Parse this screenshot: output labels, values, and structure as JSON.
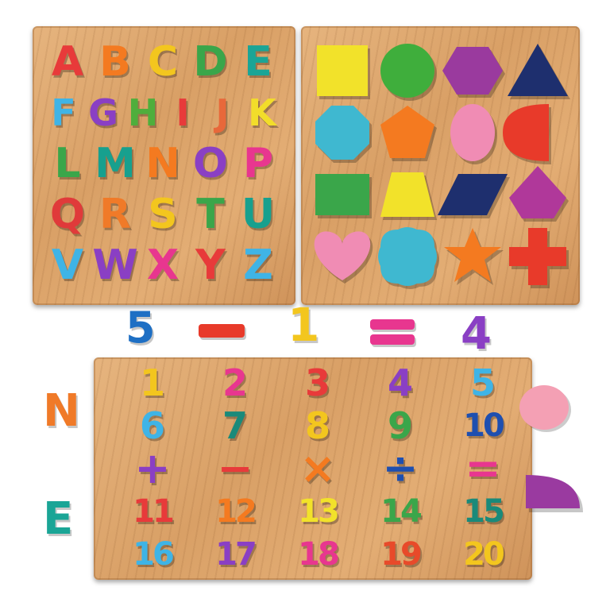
{
  "alphabet_board": {
    "letters": [
      {
        "ch": "A",
        "color": "#e83a3a"
      },
      {
        "ch": "B",
        "color": "#f47a20"
      },
      {
        "ch": "C",
        "color": "#f3c61e"
      },
      {
        "ch": "D",
        "color": "#3aa64a"
      },
      {
        "ch": "E",
        "color": "#1aa596"
      },
      {
        "ch": "F",
        "color": "#3fb4e6"
      },
      {
        "ch": "G",
        "color": "#8a3fc4"
      },
      {
        "ch": "H",
        "color": "#4fae3c"
      },
      {
        "ch": "I",
        "color": "#e83a3a"
      },
      {
        "ch": "J",
        "color": "#e8683a"
      },
      {
        "ch": "K",
        "color": "#f2dd2a"
      },
      {
        "ch": "L",
        "color": "#3aa64a"
      },
      {
        "ch": "M",
        "color": "#17a08e"
      },
      {
        "ch": "N",
        "color": "#f47a20"
      },
      {
        "ch": "O",
        "color": "#8a3fc4"
      },
      {
        "ch": "P",
        "color": "#e8368f"
      },
      {
        "ch": "Q",
        "color": "#e03a3a"
      },
      {
        "ch": "R",
        "color": "#f07a28"
      },
      {
        "ch": "S",
        "color": "#f3c61e"
      },
      {
        "ch": "T",
        "color": "#3aa64a"
      },
      {
        "ch": "U",
        "color": "#17a08e"
      },
      {
        "ch": "V",
        "color": "#3fb4e6"
      },
      {
        "ch": "W",
        "color": "#8a3fc4"
      },
      {
        "ch": "X",
        "color": "#e8368f"
      },
      {
        "ch": "Y",
        "color": "#e83a3a"
      },
      {
        "ch": "Z",
        "color": "#3fb4e6"
      }
    ]
  },
  "shape_board": {
    "shapes": [
      {
        "name": "square",
        "color": "#f2e22a"
      },
      {
        "name": "circle",
        "color": "#3fae3c"
      },
      {
        "name": "hexagon",
        "color": "#9a3a9e"
      },
      {
        "name": "triangle",
        "color": "#1e2f6e"
      },
      {
        "name": "octagon",
        "color": "#3fb8d0"
      },
      {
        "name": "pentagon",
        "color": "#f47a20"
      },
      {
        "name": "oval",
        "color": "#f08cb4"
      },
      {
        "name": "semicircle",
        "color": "#e83a2a"
      },
      {
        "name": "rectangle",
        "color": "#3aa64a"
      },
      {
        "name": "trapezoid",
        "color": "#f2e22a"
      },
      {
        "name": "parallelogram",
        "color": "#1e2f6e"
      },
      {
        "name": "kite",
        "color": "#b0389a"
      },
      {
        "name": "heart",
        "color": "#f08cb4"
      },
      {
        "name": "quatrefoil",
        "color": "#3fb8d0"
      },
      {
        "name": "star",
        "color": "#f47a20"
      },
      {
        "name": "cross",
        "color": "#e83a2a"
      }
    ]
  },
  "number_board": {
    "row1": [
      {
        "t": "1",
        "color": "#f3c61e"
      },
      {
        "t": "2",
        "color": "#e8368f"
      },
      {
        "t": "3",
        "color": "#e83a3a"
      },
      {
        "t": "4",
        "color": "#8a3fc4"
      },
      {
        "t": "5",
        "color": "#3fb4e6"
      }
    ],
    "row2": [
      {
        "t": "6",
        "color": "#3fb4e6"
      },
      {
        "t": "7",
        "color": "#1a8a7a"
      },
      {
        "t": "8",
        "color": "#f3c61e"
      },
      {
        "t": "9",
        "color": "#3aa64a"
      },
      {
        "t": "10",
        "color": "#1e4fb0"
      }
    ],
    "row3": [
      {
        "t": "+",
        "color": "#8a3fc4"
      },
      {
        "t": "−",
        "color": "#e83a3a"
      },
      {
        "t": "×",
        "color": "#f47a20"
      },
      {
        "t": "÷",
        "color": "#1e4fb0"
      },
      {
        "t": "=",
        "color": "#e8368f"
      }
    ],
    "row4": [
      {
        "t": "11",
        "color": "#e83a3a"
      },
      {
        "t": "12",
        "color": "#f47a20"
      },
      {
        "t": "13",
        "color": "#f2e22a"
      },
      {
        "t": "14",
        "color": "#3aa64a"
      },
      {
        "t": "15",
        "color": "#1a8a7a"
      }
    ],
    "row5": [
      {
        "t": "16",
        "color": "#3fb4e6"
      },
      {
        "t": "17",
        "color": "#8a3fc4"
      },
      {
        "t": "18",
        "color": "#e8368f"
      },
      {
        "t": "19",
        "color": "#e84a2a"
      },
      {
        "t": "20",
        "color": "#f3c61e"
      }
    ]
  },
  "loose_pieces": {
    "five": {
      "t": "5",
      "color": "#1e6fc4"
    },
    "minus": {
      "color": "#e83a2a"
    },
    "one": {
      "t": "1",
      "color": "#f3c61e"
    },
    "equals": {
      "color": "#e8368f"
    },
    "four": {
      "t": "4",
      "color": "#8a3fc4"
    },
    "n": {
      "t": "N",
      "color": "#f07a28"
    },
    "e": {
      "t": "E",
      "color": "#1aa596"
    },
    "oval_piece": {
      "color": "#f4a0b4"
    },
    "semicircle_piece": {
      "color": "#9a3aa0"
    }
  }
}
